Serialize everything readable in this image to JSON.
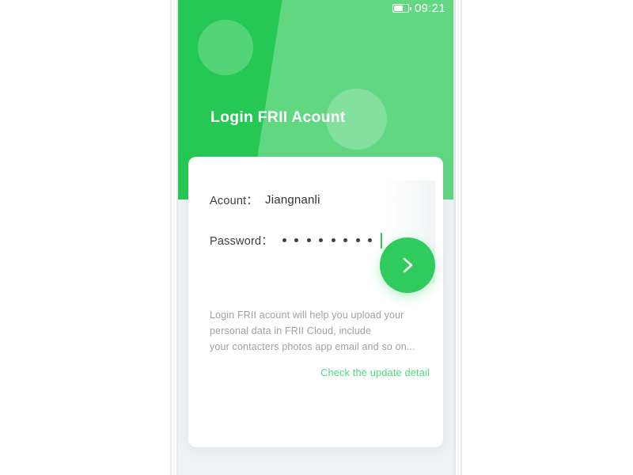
{
  "status_bar": {
    "battery_icon": "battery-icon",
    "time": "09:21"
  },
  "header": {
    "title": "Login FRII Acount",
    "background_color": "#25c853",
    "highlight_color": "#6fe89b"
  },
  "form": {
    "account": {
      "label": "Acount：",
      "value": "Jiangnanli"
    },
    "password": {
      "label": "Password：",
      "masked_char_count": 8,
      "caret_color": "#2fcc5d"
    }
  },
  "description": {
    "line1": "Login FRII acount will help you upload your",
    "line2": "personal data in FRII Cloud, include",
    "line3": "your contacters photos app email and so on..."
  },
  "update_link": {
    "label": "Check the update detail",
    "color": "#4bdc7d"
  },
  "fab": {
    "icon": "chevron-right-icon",
    "color": "#2fcc5d"
  },
  "page": {
    "background_color": "#eef2f4",
    "card_color": "#ffffff"
  }
}
